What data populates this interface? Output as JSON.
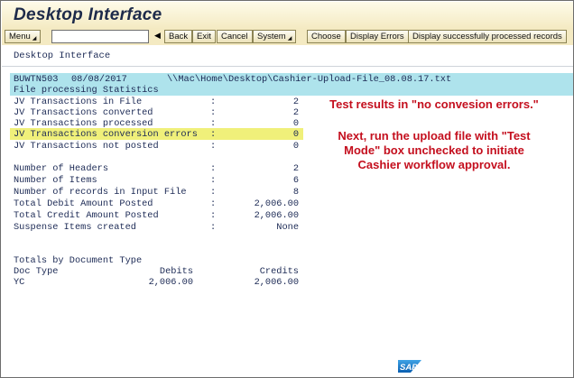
{
  "window": {
    "title": "Desktop Interface"
  },
  "toolbar": {
    "menu_label": "Menu",
    "command_value": "",
    "back_label": "Back",
    "exit_label": "Exit",
    "cancel_label": "Cancel",
    "system_label": "System",
    "choose_label": "Choose",
    "display_errors_label": "Display Errors",
    "display_processed_label": "Display successfully processed records"
  },
  "screen": {
    "subtitle": "Desktop Interface"
  },
  "header": {
    "id": "BUWTN503",
    "date": "08/08/2017",
    "path": "\\\\Mac\\Home\\Desktop\\Cashier-Upload-File_08.08.17.txt",
    "section": "File processing Statistics"
  },
  "stats": [
    {
      "label": "JV Transactions in File",
      "value": "2"
    },
    {
      "label": "JV Transactions converted",
      "value": "2"
    },
    {
      "label": "JV Transactions processed",
      "value": "0"
    },
    {
      "label": "JV Transactions conversion errors",
      "value": "0"
    },
    {
      "label": "JV Transactions not posted",
      "value": "0"
    }
  ],
  "totals": [
    {
      "label": "Number of Headers",
      "value": "2"
    },
    {
      "label": "Number of Items",
      "value": "6"
    },
    {
      "label": "Number of records in Input File",
      "value": "8"
    },
    {
      "label": "Total Debit Amount Posted",
      "value": "2,006.00"
    },
    {
      "label": "Total Credit Amount Posted",
      "value": "2,006.00"
    },
    {
      "label": "Suspense Items created",
      "value": "None"
    }
  ],
  "separator": ":",
  "doc_totals": {
    "heading": "Totals by Document Type",
    "col_doc_type": "Doc Type",
    "col_debits": "Debits",
    "col_credits": "Credits",
    "rows": [
      {
        "doc_type": "YC",
        "debits": "2,006.00",
        "credits": "2,006.00"
      }
    ]
  },
  "annotations": {
    "note1": "Test results in \"no convesion errors.\"",
    "note2_line1": "Next, run the upload file with \"Test",
    "note2_line2": "Mode\" box unchecked to initiate",
    "note2_line3": "Cashier workflow approval."
  },
  "logo": {
    "text": "SAP"
  },
  "colors": {
    "highlight_band": "#aee3ec",
    "highlight_row": "#f0f07a",
    "note_red": "#c40f1e",
    "text_navy": "#1c2a55"
  }
}
